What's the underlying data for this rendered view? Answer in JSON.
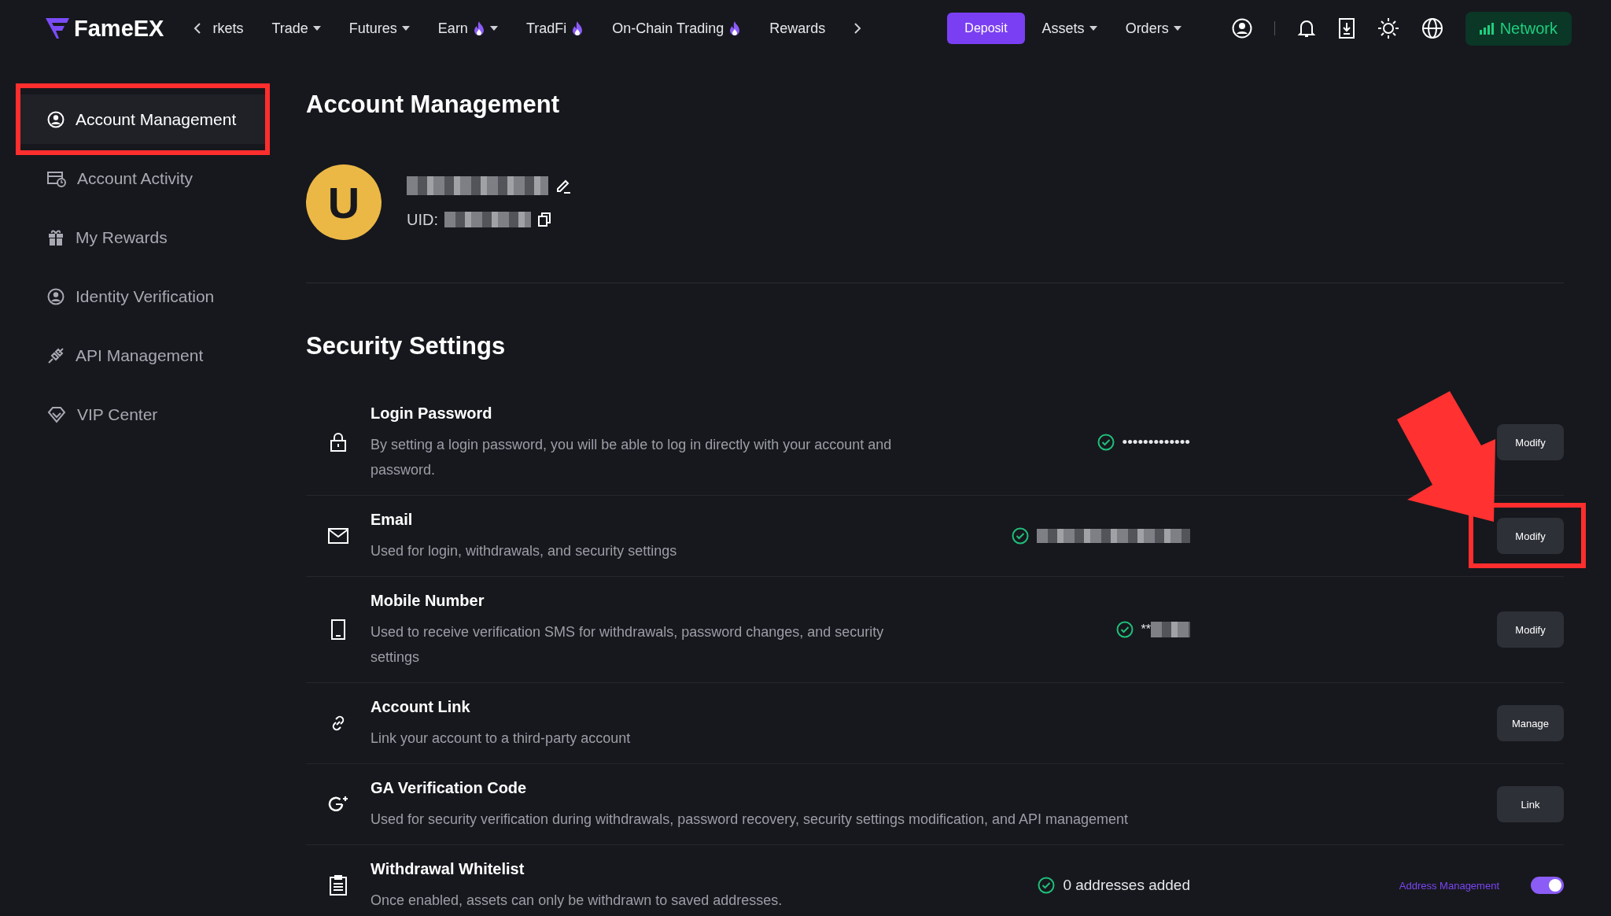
{
  "nav": {
    "logo": "FameEX",
    "items": [
      {
        "label": "rkets",
        "dropdown": false,
        "hot": false
      },
      {
        "label": "Trade",
        "dropdown": true,
        "hot": false
      },
      {
        "label": "Futures",
        "dropdown": true,
        "hot": false
      },
      {
        "label": "Earn",
        "dropdown": true,
        "hot": true
      },
      {
        "label": "TradFi",
        "dropdown": false,
        "hot": true
      },
      {
        "label": "On-Chain Trading",
        "dropdown": false,
        "hot": true
      },
      {
        "label": "Rewards",
        "dropdown": false,
        "hot": false
      }
    ],
    "deposit": "Deposit",
    "menus": [
      {
        "label": "Assets"
      },
      {
        "label": "Orders"
      }
    ],
    "network": "Network"
  },
  "sidebar": {
    "items": [
      {
        "label": "Account Management",
        "selected": true,
        "highlighted": true
      },
      {
        "label": "Account Activity",
        "selected": false,
        "highlighted": false
      },
      {
        "label": "My Rewards",
        "selected": false,
        "highlighted": false
      },
      {
        "label": "Identity Verification",
        "selected": false,
        "highlighted": false
      },
      {
        "label": "API Management",
        "selected": false,
        "highlighted": false
      },
      {
        "label": "VIP Center",
        "selected": false,
        "highlighted": false
      }
    ]
  },
  "page_title": "Account Management",
  "profile": {
    "avatar": "U",
    "uid_label": "UID:"
  },
  "security": {
    "title": "Security Settings",
    "rows": [
      {
        "title": "Login Password",
        "description": "By setting a login password, you will be able to log in directly with your account and password.",
        "status": {
          "verified": true,
          "text": "•••••••••••••",
          "redacted": false
        },
        "button": "Modify",
        "highlighted": false
      },
      {
        "title": "Email",
        "description": "Used for login, withdrawals, and security settings",
        "status": {
          "verified": true,
          "redacted": true
        },
        "button": "Modify",
        "highlighted": true
      },
      {
        "title": "Mobile Number",
        "description": "Used to receive verification SMS for withdrawals, password changes, and security settings",
        "status": {
          "verified": true,
          "text": "**",
          "redacted": true
        },
        "button": "Modify",
        "highlighted": false
      },
      {
        "title": "Account Link",
        "description": "Link your account to a third-party account",
        "button": "Manage",
        "highlighted": false
      },
      {
        "title": "GA Verification Code",
        "description": "Used for security verification during withdrawals, password recovery, security settings modification, and API management",
        "button": "Link",
        "highlighted": false
      },
      {
        "title": "Withdrawal Whitelist",
        "description": "Once enabled, assets can only be withdrawn to saved addresses.",
        "status": {
          "verified": true,
          "text": "0 addresses added",
          "redacted": false
        },
        "link": "Address Management",
        "toggle": {
          "on": true
        },
        "highlighted": false
      }
    ]
  }
}
